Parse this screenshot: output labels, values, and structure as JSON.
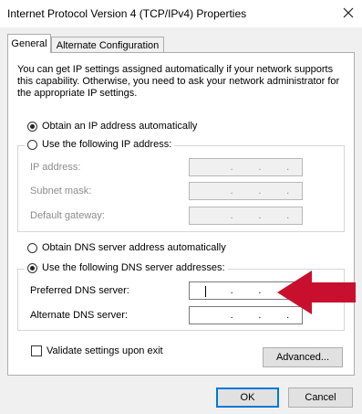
{
  "window": {
    "title": "Internet Protocol Version 4 (TCP/IPv4) Properties",
    "close_icon": "close-icon"
  },
  "tabs": [
    {
      "label": "General",
      "active": true
    },
    {
      "label": "Alternate Configuration",
      "active": false
    }
  ],
  "description": "You can get IP settings assigned automatically if your network supports this capability. Otherwise, you need to ask your network administrator for the appropriate IP settings.",
  "ip": {
    "auto_label": "Obtain an IP address automatically",
    "manual_label": "Use the following IP address:",
    "selected": "auto",
    "fields": [
      {
        "label": "IP address:",
        "dots": [
          ".",
          ".",
          "."
        ]
      },
      {
        "label": "Subnet mask:",
        "dots": [
          ".",
          ".",
          "."
        ]
      },
      {
        "label": "Default gateway:",
        "dots": [
          ".",
          ".",
          "."
        ]
      }
    ]
  },
  "dns": {
    "auto_label": "Obtain DNS server address automatically",
    "manual_label": "Use the following DNS server addresses:",
    "selected": "manual",
    "fields": [
      {
        "label": "Preferred DNS server:",
        "dots": [
          ".",
          ".",
          "."
        ]
      },
      {
        "label": "Alternate DNS server:",
        "dots": [
          ".",
          ".",
          "."
        ]
      }
    ]
  },
  "validate_label": "Validate settings upon exit",
  "validate_checked": false,
  "buttons": {
    "advanced": "Advanced...",
    "ok": "OK",
    "cancel": "Cancel"
  },
  "colors": {
    "arrow": "#c8102e",
    "default_button_border": "#0078d7"
  }
}
